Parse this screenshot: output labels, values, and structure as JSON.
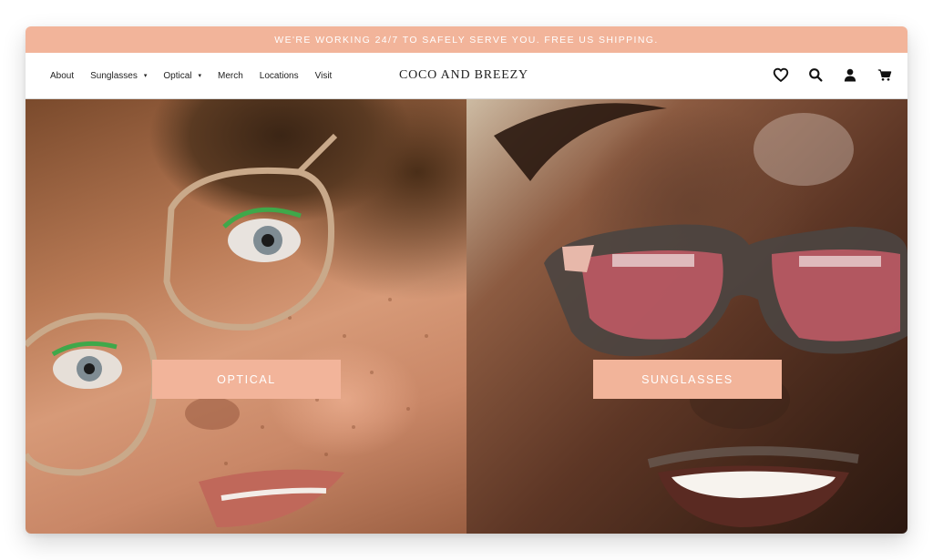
{
  "announcement": "WE'RE WORKING 24/7 TO SAFELY SERVE YOU. FREE US SHIPPING.",
  "nav": {
    "items": [
      {
        "label": "About",
        "has_dropdown": false
      },
      {
        "label": "Sunglasses",
        "has_dropdown": true
      },
      {
        "label": "Optical",
        "has_dropdown": true
      },
      {
        "label": "Merch",
        "has_dropdown": false
      },
      {
        "label": "Locations",
        "has_dropdown": false
      },
      {
        "label": "Visit",
        "has_dropdown": false
      }
    ],
    "caret": "▾"
  },
  "brand": {
    "logo": "COCO AND BREEZY"
  },
  "icons": [
    "heart-icon",
    "search-icon",
    "account-icon",
    "cart-icon"
  ],
  "hero": {
    "left_cta": "OPTICAL",
    "right_cta": "SUNGLASSES"
  },
  "colors": {
    "accent": "#f2b49a",
    "text": "#222222",
    "white": "#ffffff"
  }
}
